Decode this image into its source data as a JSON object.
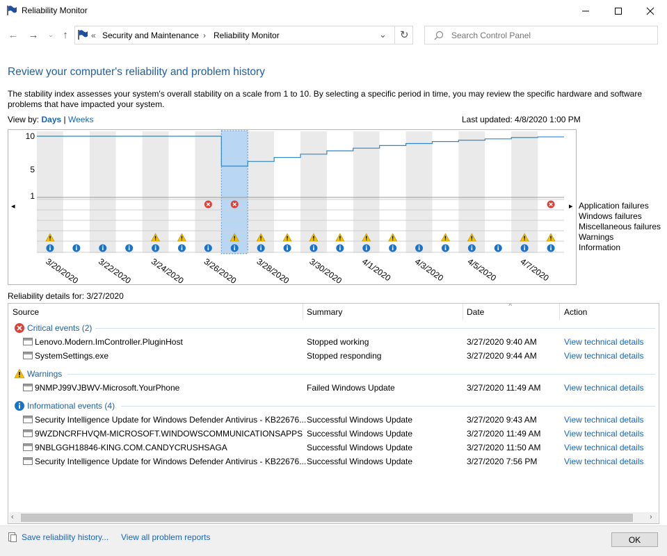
{
  "window": {
    "title": "Reliability Monitor"
  },
  "address": {
    "overflow": "«",
    "crumbs": [
      "Security and Maintenance",
      "Reliability Monitor"
    ],
    "search_placeholder": "Search Control Panel"
  },
  "heading": "Review your computer's reliability and problem history",
  "description": "The stability index assesses your system's overall stability on a scale from 1 to 10. By selecting a specific period in time, you may review the specific hardware and software problems that have impacted your system.",
  "view_by": {
    "label": "View by:",
    "days": "Days",
    "sep": "|",
    "weeks": "Weeks"
  },
  "last_updated": "Last updated: 4/8/2020 1:00 PM",
  "chart_data": {
    "type": "line",
    "y_ticks": [
      "10",
      "5",
      "1"
    ],
    "ylim": [
      1,
      10
    ],
    "x": [
      "3/20/2020",
      "3/21/2020",
      "3/22/2020",
      "3/23/2020",
      "3/24/2020",
      "3/25/2020",
      "3/26/2020",
      "3/27/2020",
      "3/28/2020",
      "3/29/2020",
      "3/30/2020",
      "3/31/2020",
      "4/1/2020",
      "4/2/2020",
      "4/3/2020",
      "4/4/2020",
      "4/5/2020",
      "4/6/2020",
      "4/7/2020",
      "4/8/2020"
    ],
    "x_tick_labels": [
      "3/20/2020",
      "3/22/2020",
      "3/24/2020",
      "3/26/2020",
      "3/28/2020",
      "3/30/2020",
      "4/1/2020",
      "4/3/2020",
      "4/5/2020",
      "4/7/2020"
    ],
    "stability_index": [
      10,
      10,
      10,
      10,
      10,
      10,
      10,
      5.5,
      6.2,
      6.8,
      7.3,
      7.8,
      8.2,
      8.6,
      8.9,
      9.2,
      9.4,
      9.6,
      9.8,
      9.9
    ],
    "selected": "3/27/2020",
    "rows": [
      "Application failures",
      "Windows failures",
      "Miscellaneous failures",
      "Warnings",
      "Information"
    ],
    "application_failures": [
      0,
      0,
      0,
      0,
      0,
      0,
      1,
      1,
      0,
      0,
      0,
      0,
      0,
      0,
      0,
      0,
      0,
      0,
      0,
      1
    ],
    "warnings": [
      1,
      0,
      0,
      0,
      1,
      1,
      0,
      1,
      1,
      1,
      1,
      1,
      1,
      1,
      0,
      1,
      1,
      0,
      1,
      1
    ],
    "information": [
      1,
      1,
      1,
      1,
      1,
      1,
      1,
      1,
      1,
      1,
      1,
      1,
      1,
      1,
      1,
      1,
      1,
      1,
      1,
      1
    ]
  },
  "details": {
    "label": "Reliability details for: 3/27/2020",
    "columns": [
      "Source",
      "Summary",
      "Date",
      "Action"
    ],
    "groups": [
      {
        "kind": "critical",
        "title": "Critical events (2)",
        "rows": [
          {
            "source": "Lenovo.Modern.ImController.PluginHost",
            "summary": "Stopped working",
            "date": "3/27/2020 9:40 AM",
            "action": "View technical details"
          },
          {
            "source": "SystemSettings.exe",
            "summary": "Stopped responding",
            "date": "3/27/2020 9:44 AM",
            "action": "View technical details"
          }
        ]
      },
      {
        "kind": "warning",
        "title": "Warnings",
        "rows": [
          {
            "source": "9NMPJ99VJBWV-Microsoft.YourPhone",
            "summary": "Failed Windows Update",
            "date": "3/27/2020 11:49 AM",
            "action": "View technical details"
          }
        ]
      },
      {
        "kind": "info",
        "title": "Informational events (4)",
        "rows": [
          {
            "source": "Security Intelligence Update for Windows Defender Antivirus - KB22676...",
            "summary": "Successful Windows Update",
            "date": "3/27/2020 9:43 AM",
            "action": "View technical details"
          },
          {
            "source": "9WZDNCRFHVQM-MICROSOFT.WINDOWSCOMMUNICATIONSAPPS",
            "summary": "Successful Windows Update",
            "date": "3/27/2020 11:49 AM",
            "action": "View technical details"
          },
          {
            "source": "9NBLGGH18846-KING.COM.CANDYCRUSHSAGA",
            "summary": "Successful Windows Update",
            "date": "3/27/2020 11:50 AM",
            "action": "View technical details"
          },
          {
            "source": "Security Intelligence Update for Windows Defender Antivirus - KB22676...",
            "summary": "Successful Windows Update",
            "date": "3/27/2020 7:56 PM",
            "action": "View technical details"
          }
        ]
      }
    ]
  },
  "footer": {
    "save": "Save reliability history...",
    "reports": "View all problem reports",
    "ok": "OK"
  },
  "colors": {
    "accent": "#1e5fa5",
    "link": "#1565c0",
    "line": "#2f86c8",
    "selected": "#b9d7f3",
    "critical": "#d9423a",
    "warning": "#f2c200",
    "info": "#1a73c9"
  }
}
